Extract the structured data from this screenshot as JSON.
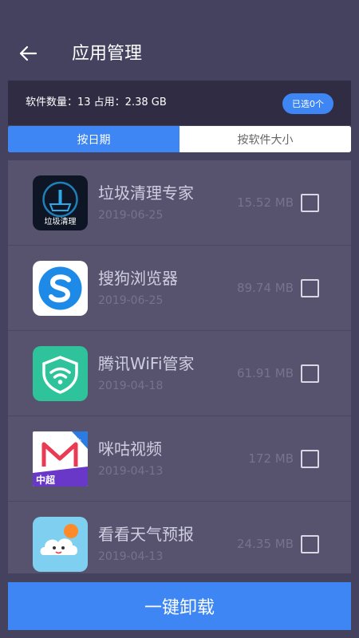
{
  "header": {
    "title": "应用管理",
    "back_icon": "arrow-left-icon"
  },
  "summary": {
    "text": "软件数量：13 占用：2.38 GB",
    "selected_label": "已选0个"
  },
  "tabs": [
    {
      "label": "按日期",
      "active": true
    },
    {
      "label": "按软件大小",
      "active": false
    }
  ],
  "apps": [
    {
      "name": "垃圾清理专家",
      "date": "2019-06-25",
      "size": "15.52 MB",
      "icon": "broom-cleaner-icon",
      "icon_label": "垃圾清理"
    },
    {
      "name": "搜狗浏览器",
      "date": "2019-06-25",
      "size": "89.74 MB",
      "icon": "sogou-browser-icon"
    },
    {
      "name": "腾讯WiFi管家",
      "date": "2019-04-18",
      "size": "61.91 MB",
      "icon": "wifi-shield-icon"
    },
    {
      "name": "咪咕视频",
      "date": "2019-04-13",
      "size": "172 MB",
      "icon": "migu-video-icon",
      "icon_label": "中超",
      "icon_badge": "IPV6"
    },
    {
      "name": "看看天气预报",
      "date": "2019-04-13",
      "size": "24.35 MB",
      "icon": "weather-cloud-icon"
    }
  ],
  "footer": {
    "uninstall_label": "一键卸载"
  },
  "colors": {
    "background": "#45425f",
    "accent": "#3d86f4",
    "list_bg": "#57536f",
    "summary_bg": "#2f2c43"
  }
}
